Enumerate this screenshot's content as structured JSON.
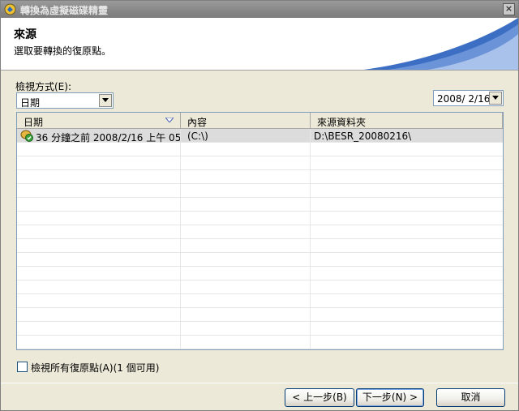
{
  "window": {
    "title": "轉換為虛擬磁碟精靈",
    "close": "×"
  },
  "header": {
    "title": "來源",
    "subtitle": "選取要轉換的復原點。"
  },
  "view": {
    "label": "檢視方式(E):",
    "selected": "日期",
    "date_selected": "2008/ 2/16"
  },
  "table": {
    "columns": [
      "日期",
      "內容",
      "來源資料夾"
    ],
    "rows": [
      {
        "date": "36 分鐘之前 2008/2/16 上午 05...",
        "content": "(C:\\)",
        "folder": "D:\\BESR_20080216\\"
      }
    ]
  },
  "options": {
    "show_all_label": "檢視所有復原點(A)(1 個可用)"
  },
  "buttons": {
    "back": "< 上一步(B)",
    "next": "下一步(N) >",
    "cancel": "取消"
  }
}
